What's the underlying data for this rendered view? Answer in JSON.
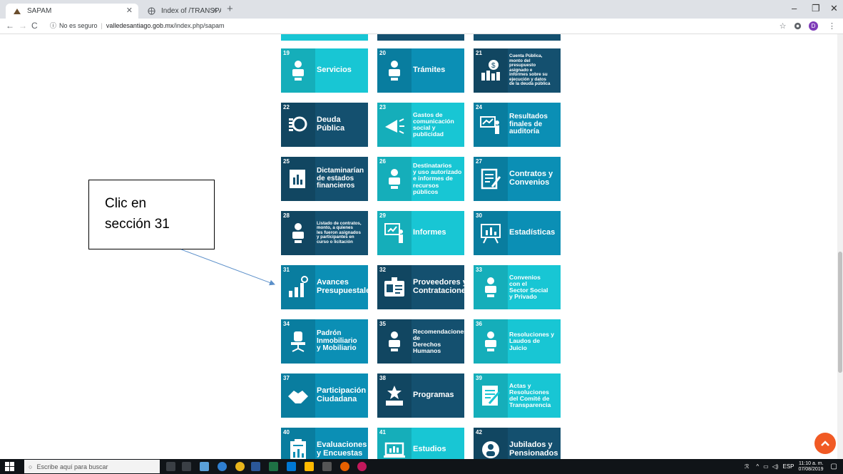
{
  "browser": {
    "tabs": [
      {
        "title": "SAPAM",
        "icon": "site-favicon"
      },
      {
        "title": "Index of /TRANSPARENCIA/CON",
        "icon": "globe-icon"
      }
    ],
    "new_tab": "+",
    "window_controls": {
      "minimize": "–",
      "maximize": "❐",
      "close": "✕"
    },
    "nav": {
      "back": "←",
      "forward": "→",
      "reload": "C"
    },
    "security_label": "No es seguro",
    "url_host": "valledesantiago.gob.mx",
    "url_path": "/index.php/sapam",
    "profile_initial": "D"
  },
  "tiles": [
    {
      "num": "19",
      "title": "Servicios",
      "color": "#18c6d4",
      "icon": "people-service-icon"
    },
    {
      "num": "20",
      "title": "Trámites",
      "color": "#0b8fb5",
      "icon": "desk-person-icon"
    },
    {
      "num": "21",
      "title": "Cuenta Pública,\nmonto del\npresupuesto\nasignado e\ninformes sobre su\nejecución y datos\nde la deuda pública",
      "color": "#14506f",
      "icon": "money-chart-icon"
    },
    {
      "num": "22",
      "title": "Deuda\nPública",
      "color": "#14506f",
      "icon": "coins-icon"
    },
    {
      "num": "23",
      "title": "Gastos de\ncomunicación\nsocial y\npublicidad",
      "color": "#18c6d4",
      "icon": "megaphone-icon"
    },
    {
      "num": "24",
      "title": "Resultados\nfinales de\nauditoría",
      "color": "#0b8fb5",
      "icon": "audit-icon"
    },
    {
      "num": "25",
      "title": "Dictaminarían\nde estados\nfinancieros",
      "color": "#14506f",
      "icon": "report-chart-icon"
    },
    {
      "num": "26",
      "title": "Destinatarios\ny uso autorizado\ne informes de\nrecursos públicos",
      "color": "#18c6d4",
      "icon": "arrows-person-icon"
    },
    {
      "num": "27",
      "title": "Contratos y\nConvenios",
      "color": "#0b8fb5",
      "icon": "contract-pen-icon"
    },
    {
      "num": "28",
      "title": "Listado de contratos,\nmonto, a quienes\nles fueron asignados\ny participantes en\ncurso o licitación",
      "color": "#14506f",
      "icon": "group-meeting-icon"
    },
    {
      "num": "29",
      "title": "Informes",
      "color": "#18c6d4",
      "icon": "presentation-icon"
    },
    {
      "num": "30",
      "title": "Estadísticas",
      "color": "#0b8fb5",
      "icon": "stats-board-icon"
    },
    {
      "num": "31",
      "title": "Avances\nPresupuestales",
      "color": "#0b8fb5",
      "icon": "growth-bars-icon"
    },
    {
      "num": "32",
      "title": "Proveedores y\nContrataciones",
      "color": "#14506f",
      "icon": "id-card-icon"
    },
    {
      "num": "33",
      "title": "Convenios\ncon el\nSector Social\ny Privado",
      "color": "#18c6d4",
      "icon": "agreement-people-icon"
    },
    {
      "num": "34",
      "title": "Padrón\nInmobiliario\ny Mobiliario",
      "color": "#0b8fb5",
      "icon": "office-chair-icon"
    },
    {
      "num": "35",
      "title": "Recomendaciones\nde\nDerechos Humanos",
      "color": "#14506f",
      "icon": "eye-people-icon"
    },
    {
      "num": "36",
      "title": "Resoluciones y\nLaudos de Juicio",
      "color": "#18c6d4",
      "icon": "board-meeting-icon"
    },
    {
      "num": "37",
      "title": "Participación\nCiudadana",
      "color": "#0b8fb5",
      "icon": "handshake-icon"
    },
    {
      "num": "38",
      "title": "Programas",
      "color": "#14506f",
      "icon": "award-star-icon"
    },
    {
      "num": "39",
      "title": "Actas y\nResoluciones\ndel Comité de\nTransparencia",
      "color": "#18c6d4",
      "icon": "document-pen-icon"
    },
    {
      "num": "40",
      "title": "Evaluaciones\ny Encuestas",
      "color": "#0b8fb5",
      "icon": "clipboard-chart-icon"
    },
    {
      "num": "41",
      "title": "Estudios",
      "color": "#18c6d4",
      "icon": "laptop-chart-icon"
    },
    {
      "num": "42",
      "title": "Jubilados y\nPensionados",
      "color": "#14506f",
      "icon": "gear-person-icon"
    }
  ],
  "annotation": {
    "text": "Clic en\nsección 31"
  },
  "taskbar": {
    "search_placeholder": "Escribe aquí para buscar",
    "lang": "ESP",
    "time": "11:10 a. m.",
    "date": "07/08/2019"
  }
}
